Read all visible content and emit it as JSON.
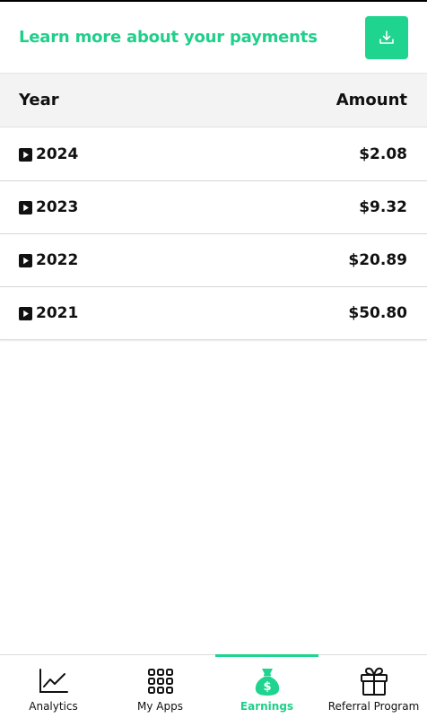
{
  "header": {
    "title": "Learn more about your payments",
    "download_icon": "download-icon"
  },
  "table": {
    "columns": [
      "Year",
      "Amount"
    ],
    "rows": [
      {
        "year": "2024",
        "amount": "$2.08"
      },
      {
        "year": "2023",
        "amount": "$9.32"
      },
      {
        "year": "2022",
        "amount": "$20.89"
      },
      {
        "year": "2021",
        "amount": "$50.80"
      }
    ]
  },
  "bottom_nav": {
    "items": [
      {
        "label": "Analytics",
        "icon": "chart-line-icon"
      },
      {
        "label": "My Apps",
        "icon": "grid-icon"
      },
      {
        "label": "Earnings",
        "icon": "money-bag-icon",
        "active": true
      },
      {
        "label": "Referral Program",
        "icon": "gift-icon"
      }
    ],
    "active_index": 2
  },
  "colors": {
    "accent": "#1fd48e",
    "accent_text": "#1fcf8a",
    "text": "#111111",
    "header_bg": "#f3f3f3"
  }
}
